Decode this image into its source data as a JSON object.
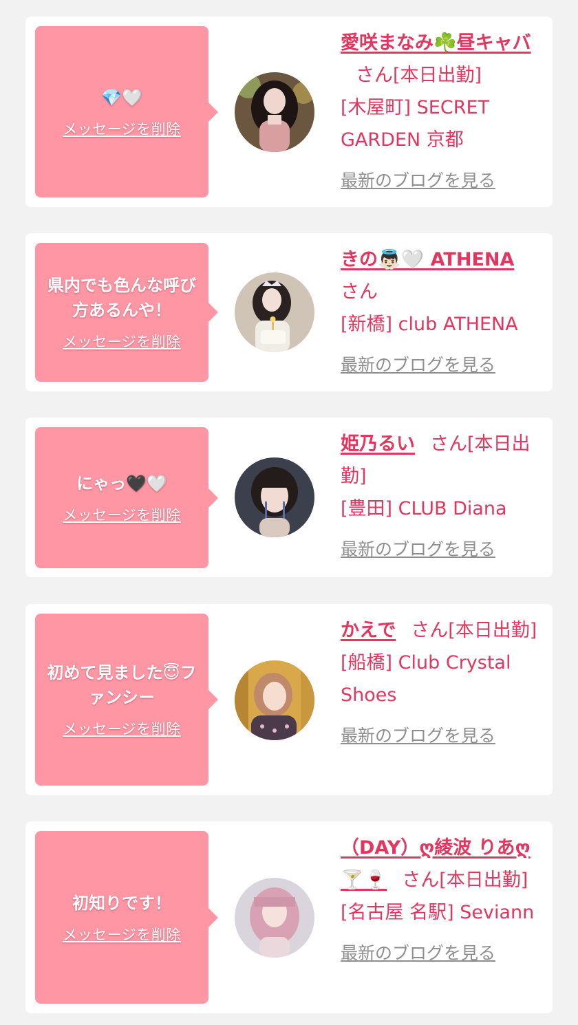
{
  "delete_label": "メッセージを削除",
  "blog_label": "最新のブログを見る",
  "cards": [
    {
      "message": "💎🤍",
      "name": "愛咲まなみ☘️昼キャバ",
      "honorific": "さん",
      "status": "[本日出勤]",
      "shop": "[木屋町] SECRET GARDEN 京都",
      "avatar_icon": "woman-dark-hair-avatar-icon"
    },
    {
      "message": "県内でも色んな呼び方あるんや！",
      "name": "きの👼🏻🤍 ATHENA",
      "honorific": "さん",
      "status": "",
      "shop": "[新橋] club ATHENA",
      "avatar_icon": "woman-birthday-cake-avatar-icon"
    },
    {
      "message": "にゃっ🖤🤍",
      "name": "姫乃るい",
      "honorific": "さん",
      "status": "[本日出勤]",
      "shop": "[豊田] CLUB Diana",
      "avatar_icon": "woman-bob-hair-avatar-icon"
    },
    {
      "message": "初めて見ました😇ファンシー",
      "name": "かえで",
      "honorific": "さん",
      "status": "[本日出勤]",
      "shop": "[船橋] Club Crystal Shoes",
      "avatar_icon": "woman-gold-background-avatar-icon"
    },
    {
      "message": "初知りです！",
      "name": "（DAY）ღ綾波 りあღ🍸🍷",
      "honorific": "さん",
      "status": "[本日出勤]",
      "shop": "[名古屋 名駅] Seviann",
      "avatar_icon": "woman-pink-hair-avatar-icon"
    }
  ],
  "colors": {
    "background": "#f2f2f2",
    "card": "#ffffff",
    "bubble": "#fe96a4",
    "accent_text": "#e2365f",
    "link_gray": "#8e8e8e"
  }
}
